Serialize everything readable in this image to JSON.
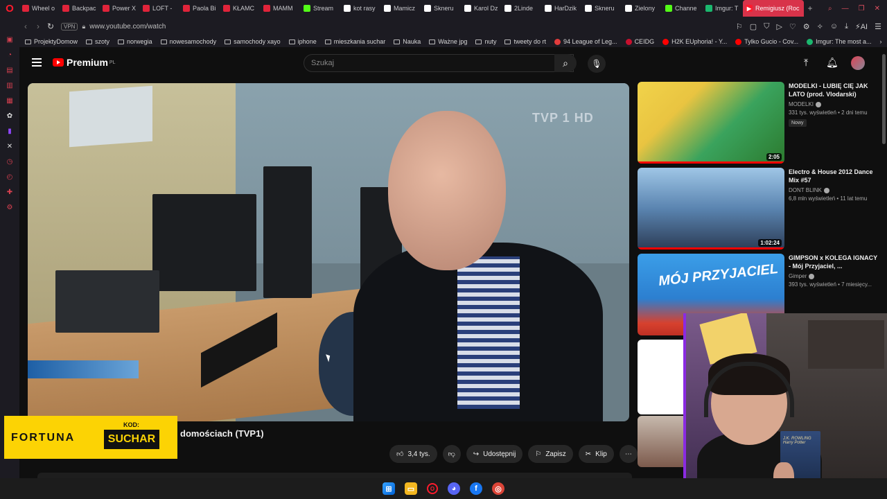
{
  "browser": {
    "tabs": [
      {
        "label": "Wheel o",
        "color": "#e0243a"
      },
      {
        "label": "Backpac",
        "color": "#e0243a"
      },
      {
        "label": "Power X",
        "color": "#e0243a"
      },
      {
        "label": "LOFT -",
        "color": "#e0243a"
      },
      {
        "label": "Paola Bi",
        "color": "#e0243a"
      },
      {
        "label": "KŁAMC",
        "color": "#e0243a"
      },
      {
        "label": "MAMM",
        "color": "#e0243a"
      },
      {
        "label": "Stream",
        "color": "#53fc18"
      },
      {
        "label": "kot rasy",
        "color": "#ffffff"
      },
      {
        "label": "Mamicz",
        "color": "#ffffff"
      },
      {
        "label": "Skneru",
        "color": "#ffffff"
      },
      {
        "label": "Karol Dz",
        "color": "#ffffff"
      },
      {
        "label": "2Linde",
        "color": "#ffffff"
      },
      {
        "label": "HarDzik",
        "color": "#ffffff"
      },
      {
        "label": "Skneru",
        "color": "#ffffff"
      },
      {
        "label": "Zielony",
        "color": "#ffffff"
      },
      {
        "label": "Channe",
        "color": "#53fc18"
      },
      {
        "label": "Imgur: T",
        "color": "#1bb76e"
      }
    ],
    "active_tab": {
      "label": "Remigiusz (Roc",
      "color": "#e0243a"
    },
    "url": "www.youtube.com/watch",
    "vpn_label": "VPN",
    "ai_label": "AI",
    "bookmarks": [
      {
        "label": "ProjektyDomow",
        "type": "folder"
      },
      {
        "label": "szoty",
        "type": "folder"
      },
      {
        "label": "norwegia",
        "type": "folder"
      },
      {
        "label": "nowesamochody",
        "type": "folder"
      },
      {
        "label": "samochody xayo",
        "type": "folder"
      },
      {
        "label": "iphone",
        "type": "folder"
      },
      {
        "label": "mieszkania suchar",
        "type": "folder"
      },
      {
        "label": "Nauka",
        "type": "folder"
      },
      {
        "label": "Ważne jpg",
        "type": "folder"
      },
      {
        "label": "nuty",
        "type": "folder"
      },
      {
        "label": "tweety do rt",
        "type": "folder"
      },
      {
        "label": "94 League of Leg...",
        "type": "site",
        "color": "#e23c3c"
      },
      {
        "label": "CEIDG",
        "type": "site",
        "color": "#c8102e"
      },
      {
        "label": "H2K EUphoria! - Y...",
        "type": "site",
        "color": "#ff0000"
      },
      {
        "label": "Tylko Gucio - Cov...",
        "type": "site",
        "color": "#ff0000"
      },
      {
        "label": "Imgur: The most a...",
        "type": "site",
        "color": "#1bb76e"
      }
    ]
  },
  "youtube": {
    "logo_text": "Premium",
    "logo_region": "PL",
    "search_placeholder": "Szukaj",
    "video": {
      "watermark": "TVP 1 HD",
      "title_visible": "domościach (TVP1)",
      "likes": "3,4 tys.",
      "share_label": "Udostępnij",
      "save_label": "Zapisz",
      "clip_label": "Klip"
    },
    "recommendations": [
      {
        "title": "MODELKI - LUBIĘ CIĘ JAK LATO (prod. Vlodarski)",
        "channel": "MODELKI",
        "meta": "331 tys. wyświetleń • 2 dni temu",
        "badge": "Nowy",
        "duration": "2:05"
      },
      {
        "title": "Electro & House 2012 Dance Mix #57",
        "channel": "DONT BLINK",
        "meta": "6,8 mln wyświetleń • 11 lat temu",
        "badge": "",
        "duration": "1:02:24"
      },
      {
        "title": "GIMPSON x KOLEGA IGNACY - Mój Przyjaciel, ...",
        "channel": "Gimper",
        "meta": "393 tys. wyświetleń • 7 miesięcy...",
        "badge": "",
        "duration": "",
        "thumb_text": "MÓJ PRZYJACIEL"
      }
    ]
  },
  "overlay": {
    "sponsor_name": "FORTUNA",
    "code_label": "KOD:",
    "code_value": "SUCHAR",
    "book_title": "J.K. ROWLING Harry Potter"
  },
  "taskbar": {
    "icons": [
      "windows-start-icon",
      "file-explorer-icon",
      "opera-icon",
      "discord-icon",
      "facebook-icon",
      "chrome-icon"
    ]
  },
  "colors": {
    "youtube_red": "#ff0000",
    "opera_red": "#ff1b2d",
    "fortuna_yellow": "#fcd304"
  }
}
